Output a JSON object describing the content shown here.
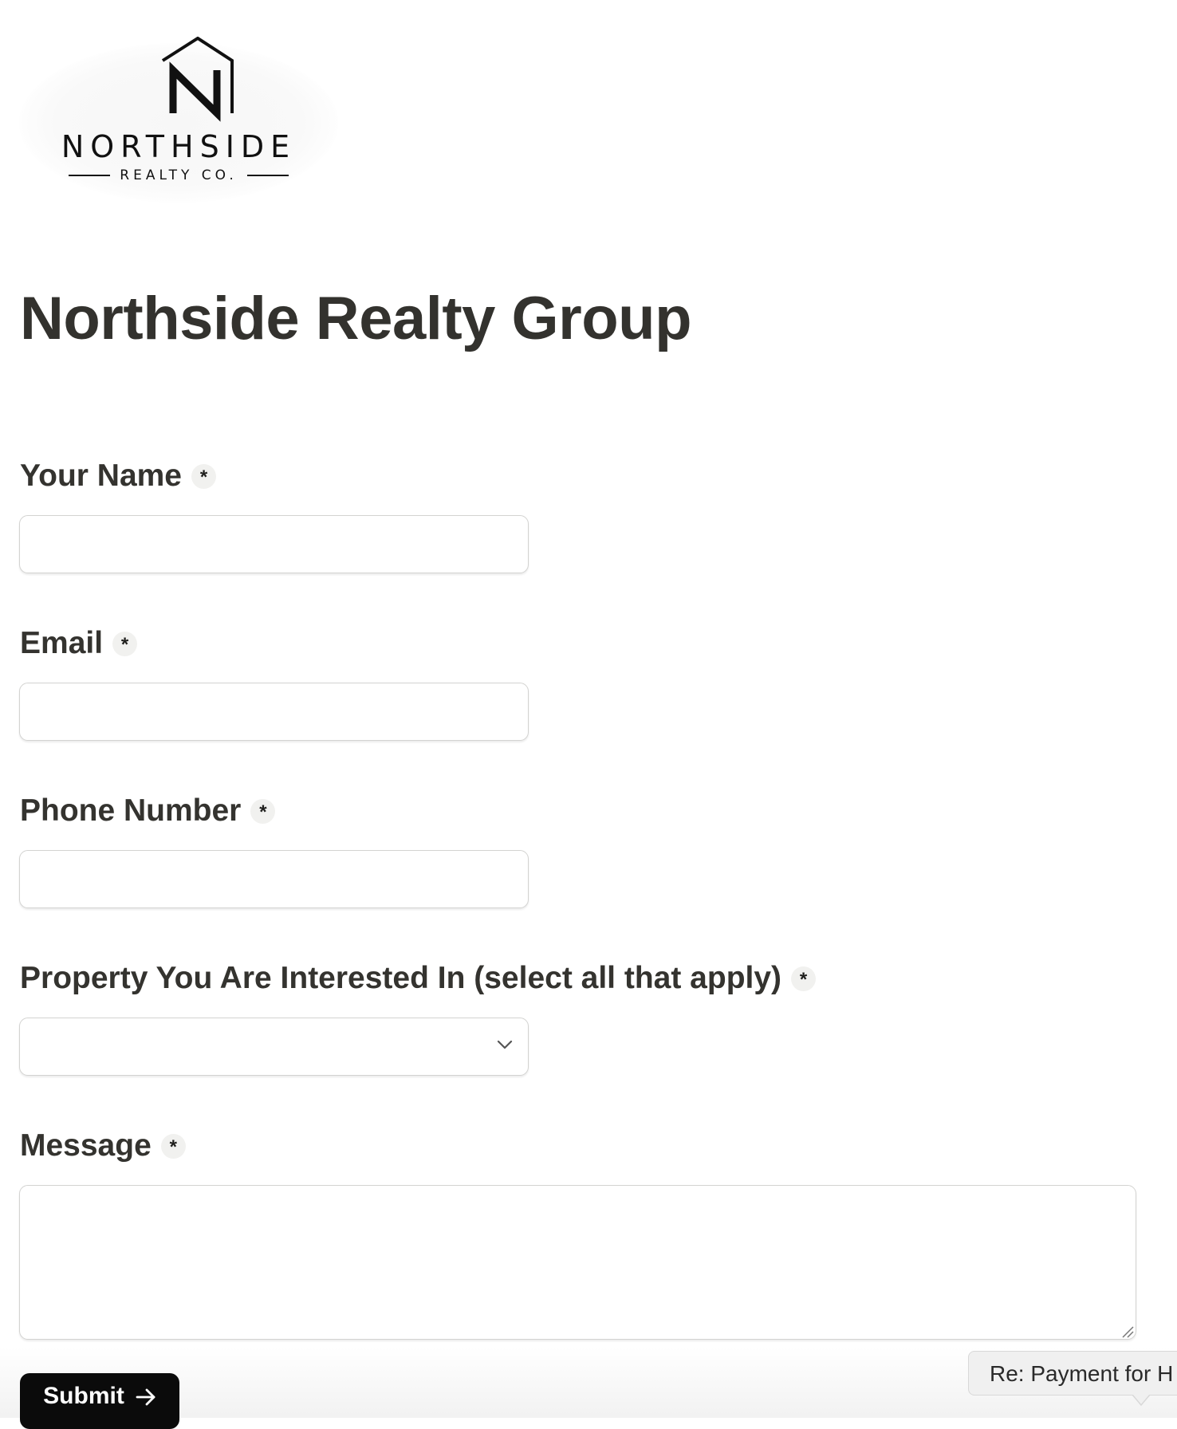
{
  "logo": {
    "name": "NORTHSIDE",
    "subtitle": "REALTY CO."
  },
  "page": {
    "title": "Northside Realty Group"
  },
  "form": {
    "fields": {
      "name": {
        "label": "Your Name",
        "required_mark": "*",
        "value": ""
      },
      "email": {
        "label": "Email",
        "required_mark": "*",
        "value": ""
      },
      "phone": {
        "label": "Phone Number",
        "required_mark": "*",
        "value": ""
      },
      "property": {
        "label": "Property You Are Interested In (select all that apply)",
        "required_mark": "*",
        "value": ""
      },
      "message": {
        "label": "Message",
        "required_mark": "*",
        "value": ""
      }
    },
    "submit_label": "Submit"
  },
  "tooltip": {
    "text": "Re: Payment for H"
  },
  "colors": {
    "text": "#34332f",
    "button_bg": "#0b0b0b",
    "border": "#d3d3d1",
    "required_badge_bg": "#f1f1ef"
  },
  "icons": {
    "logo_mark": "house-n-logo",
    "select_chevron": "chevron-down-icon",
    "submit_arrow": "arrow-right-icon",
    "resize": "resize-handle-icon"
  }
}
